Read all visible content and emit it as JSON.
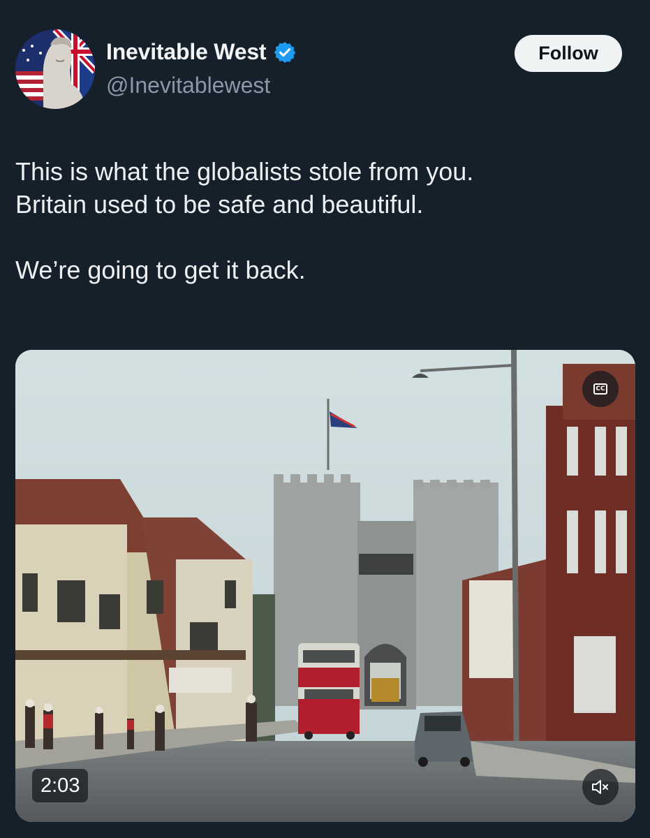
{
  "author": {
    "display_name": "Inevitable West",
    "handle": "@Inevitablewest",
    "verified": true,
    "avatar_icon": "statue-flags-avatar"
  },
  "follow_button": {
    "label": "Follow"
  },
  "tweet": {
    "lines": [
      "This is what the globalists stole from you.",
      "Britain used to be safe and beautiful.",
      "",
      "We’re going to get it back."
    ]
  },
  "video": {
    "duration": "2:03",
    "cc_label": "CC",
    "cc_icon": "closed-captions-icon",
    "mute_icon": "muted-speaker-icon"
  },
  "colors": {
    "background": "#16202a",
    "verified_badge": "#1d9bf0",
    "handle_gray": "#8b98a5",
    "follow_bg": "#eff3f4"
  }
}
